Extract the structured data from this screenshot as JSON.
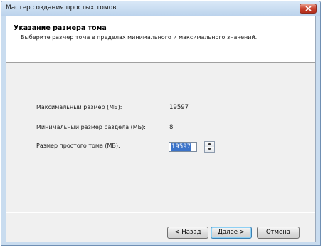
{
  "window": {
    "title": "Мастер создания простых томов"
  },
  "header": {
    "title": "Указание размера тома",
    "subtitle": "Выберите размер тома в пределах минимального и максимального значений."
  },
  "fields": {
    "max_label": "Максимальный размер (МБ):",
    "max_value": "19597",
    "min_label": "Минимальный размер раздела (МБ):",
    "min_value": "8",
    "size_label": "Размер простого тома (МБ):",
    "size_value": "19597"
  },
  "buttons": {
    "back": "< Назад",
    "next": "Далее >",
    "cancel": "Отмена"
  },
  "colors": {
    "selection": "#3b73c9",
    "close_button": "#c8412d"
  }
}
